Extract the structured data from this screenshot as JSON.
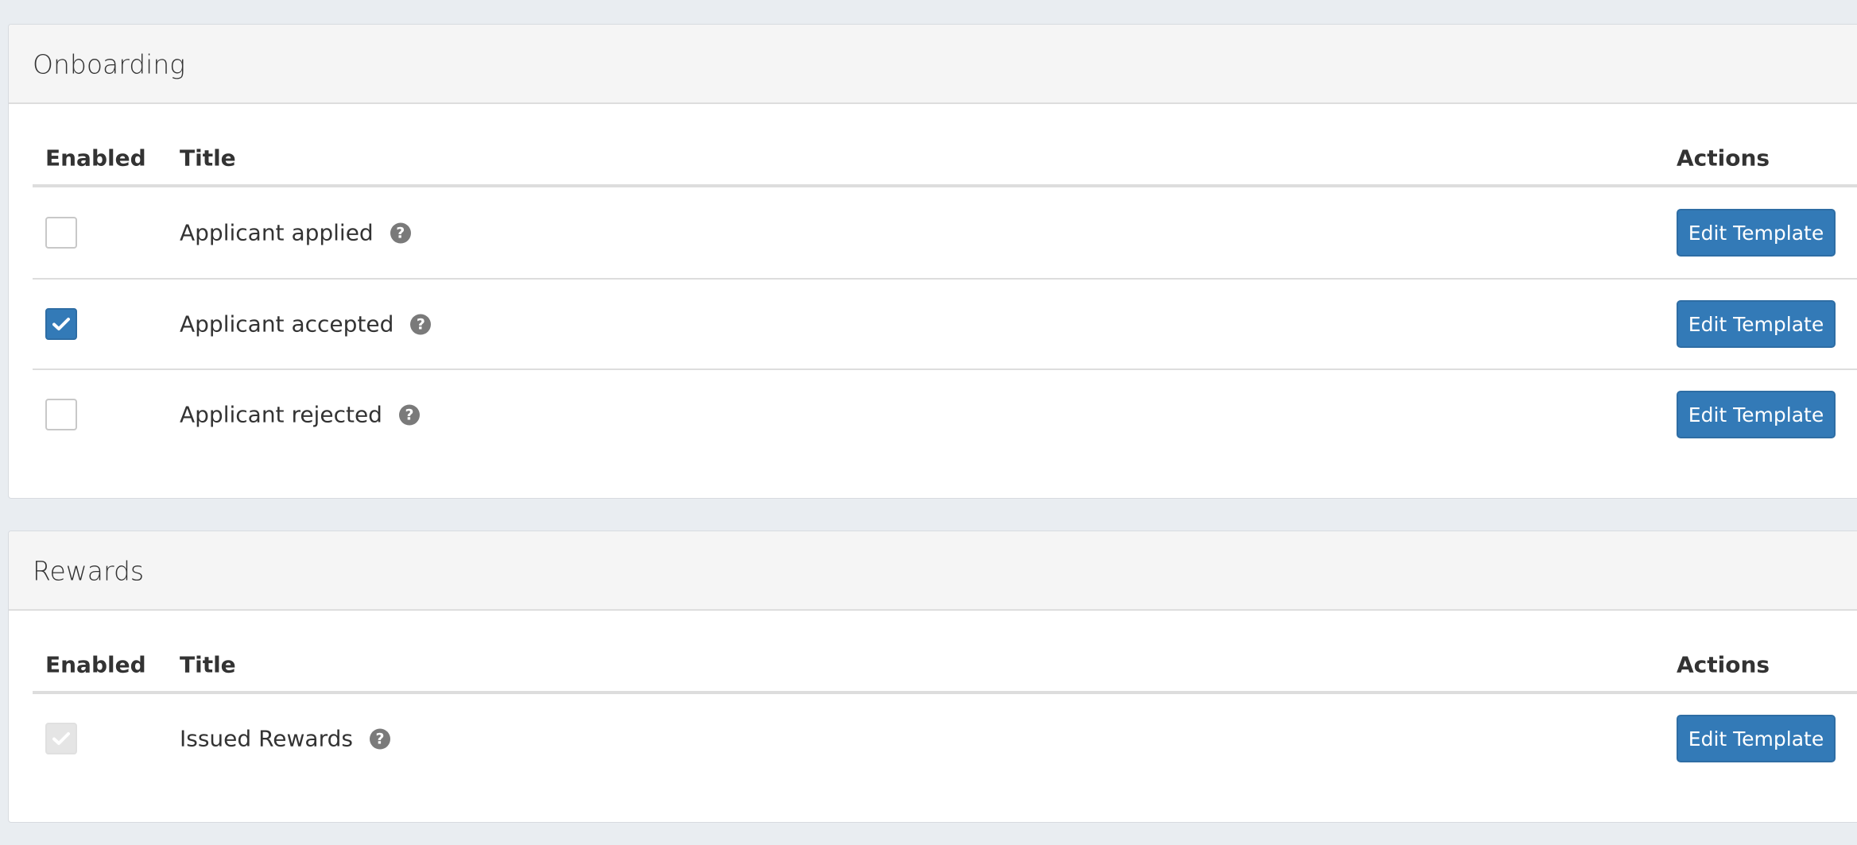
{
  "colors": {
    "page_background": "#e9edf1",
    "panel_header": "#f5f5f5",
    "primary": "#337ab7",
    "disabled_checkbox": "#e5e5e5",
    "help_icon": "#7a7a7a"
  },
  "sections": [
    {
      "title": "Onboarding",
      "columns": {
        "enabled": "Enabled",
        "title": "Title",
        "actions": "Actions"
      },
      "rows": [
        {
          "title": "Applicant applied",
          "enabled": false,
          "disabled": false,
          "help_icon": "question-circle-icon",
          "action_label": "Edit Template"
        },
        {
          "title": "Applicant accepted",
          "enabled": true,
          "disabled": false,
          "help_icon": "question-circle-icon",
          "action_label": "Edit Template"
        },
        {
          "title": "Applicant rejected",
          "enabled": false,
          "disabled": false,
          "help_icon": "question-circle-icon",
          "action_label": "Edit Template"
        }
      ]
    },
    {
      "title": "Rewards",
      "columns": {
        "enabled": "Enabled",
        "title": "Title",
        "actions": "Actions"
      },
      "rows": [
        {
          "title": "Issued Rewards",
          "enabled": true,
          "disabled": true,
          "help_icon": "question-circle-icon",
          "action_label": "Edit Template"
        }
      ]
    }
  ]
}
